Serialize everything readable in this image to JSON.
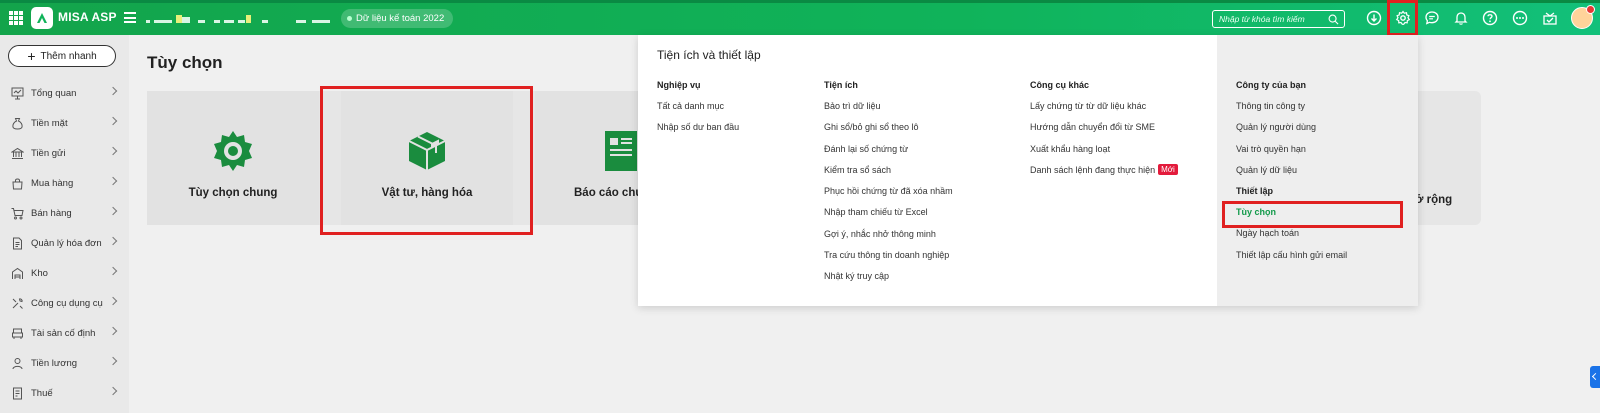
{
  "header": {
    "app_name": "MISA ASP",
    "data_badge": "Dữ liệu kế toán 2022",
    "search_placeholder": "Nhập từ khóa tìm kiếm",
    "notification_count": "2"
  },
  "sidebar": {
    "add_button": "Thêm nhanh",
    "items": [
      {
        "label": "Tổng quan",
        "icon": "dashboard-icon"
      },
      {
        "label": "Tiền mặt",
        "icon": "money-bag-icon"
      },
      {
        "label": "Tiền gửi",
        "icon": "bank-icon"
      },
      {
        "label": "Mua hàng",
        "icon": "shopping-bag-icon"
      },
      {
        "label": "Bán hàng",
        "icon": "cart-icon"
      },
      {
        "label": "Quản lý hóa đơn",
        "icon": "invoice-icon"
      },
      {
        "label": "Kho",
        "icon": "warehouse-icon"
      },
      {
        "label": "Công cụ dụng cụ",
        "icon": "tools-icon"
      },
      {
        "label": "Tài sản cố định",
        "icon": "asset-icon"
      },
      {
        "label": "Tiền lương",
        "icon": "salary-icon"
      },
      {
        "label": "Thuế",
        "icon": "tax-icon"
      }
    ]
  },
  "main": {
    "title": "Tùy chọn",
    "cards": [
      {
        "label": "Tùy chọn chung",
        "icon": "gear-icon"
      },
      {
        "label": "Vật tư, hàng hóa",
        "icon": "box-icon"
      },
      {
        "label": "Báo cáo chú",
        "icon": "report-icon"
      }
    ],
    "extra_card_label": "mở rộng"
  },
  "dropdown": {
    "title": "Tiện ích và thiết lập",
    "columns": [
      {
        "heading": "Nghiệp vụ",
        "items": [
          "Tất cả danh mục",
          "Nhập số dư ban đầu"
        ]
      },
      {
        "heading": "Tiện ích",
        "items": [
          "Bảo trì dữ liệu",
          "Ghi sổ/bỏ ghi sổ theo lô",
          "Đánh lại số chứng từ",
          "Kiểm tra sổ sách",
          "Phục hồi chứng từ đã xóa nhầm",
          "Nhập tham chiếu từ Excel",
          "Gợi ý, nhắc nhở thông minh",
          "Tra cứu thông tin doanh nghiệp",
          "Nhật ký truy cập"
        ]
      },
      {
        "heading": "Công cụ khác",
        "items": [
          "Lấy chứng từ từ dữ liệu khác",
          "Hướng dẫn chuyển đổi từ SME",
          "Xuất khẩu hàng loạt",
          "Danh sách lệnh đang thực hiện"
        ],
        "new_badge": "Mới"
      },
      {
        "heading": "Công ty của bạn",
        "items": [
          "Thông tin công ty",
          "Quản lý người dùng",
          "Vai trò quyền hạn",
          "Quản lý dữ liệu"
        ],
        "heading2": "Thiết lập",
        "items2": [
          "Tùy chọn",
          "Ngày hạch toán",
          "Thiết lập cấu hình gửi email"
        ]
      }
    ]
  },
  "colors": {
    "brand_green": "#10b35a",
    "active_green": "#129a4a",
    "highlight_red": "#e02020",
    "new_badge": "#e31b3c"
  }
}
